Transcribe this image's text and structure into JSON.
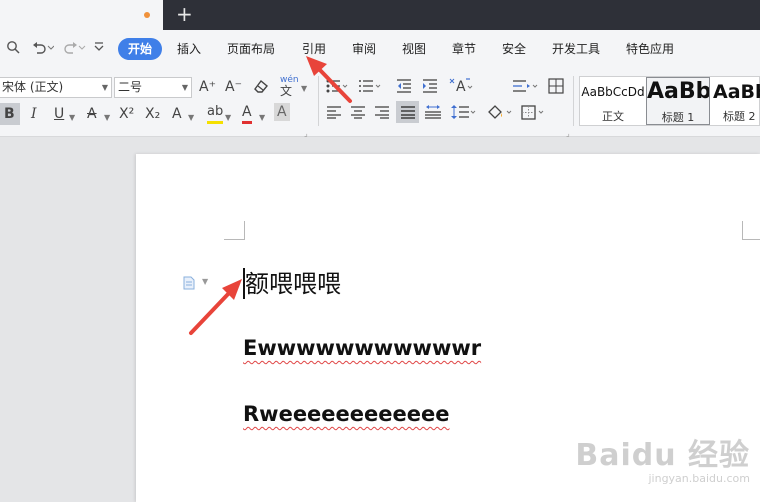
{
  "tabbar": {
    "new_tab": "+"
  },
  "quick_access": {
    "preview_icon": "print-preview-icon",
    "undo_icon": "undo-icon",
    "redo_icon": "redo-icon",
    "customize_icon": "chevron-down-icon"
  },
  "menu": {
    "items": [
      "开始",
      "插入",
      "页面布局",
      "引用",
      "审阅",
      "视图",
      "章节",
      "安全",
      "开发工具",
      "特色应用"
    ],
    "active": "开始"
  },
  "ribbon": {
    "font_family": "宋体 (正文)",
    "font_size": "二号",
    "grow_font": "A⁺",
    "shrink_font": "A⁻",
    "phonetic": "wén",
    "bold": "B",
    "italic": "I",
    "underline": "U",
    "strike_color": "A",
    "superscript": "X²",
    "subscript": "X₂",
    "text_effect": "A",
    "highlight": "ab",
    "font_color": "A",
    "char_shading": "A",
    "highlight_color": "#f5e000",
    "font_color_value": "#e03030"
  },
  "styles": [
    {
      "sample": "AaBbCcDd",
      "name": "正文"
    },
    {
      "sample": "AaBb",
      "name": "标题 1"
    },
    {
      "sample": "AaBb",
      "name": "标题 2"
    }
  ],
  "document": {
    "lines": [
      "额喂喂喂",
      "Ewwwwwwwwwwwr",
      "Rweeeeeeeeeeee"
    ]
  },
  "watermark": {
    "brand": "Baidu 经验",
    "url": "jingyan.baidu.com"
  },
  "colors": {
    "accent": "#3f7fe8",
    "arrow": "#e8443a",
    "spellcheck": "#e04545"
  }
}
